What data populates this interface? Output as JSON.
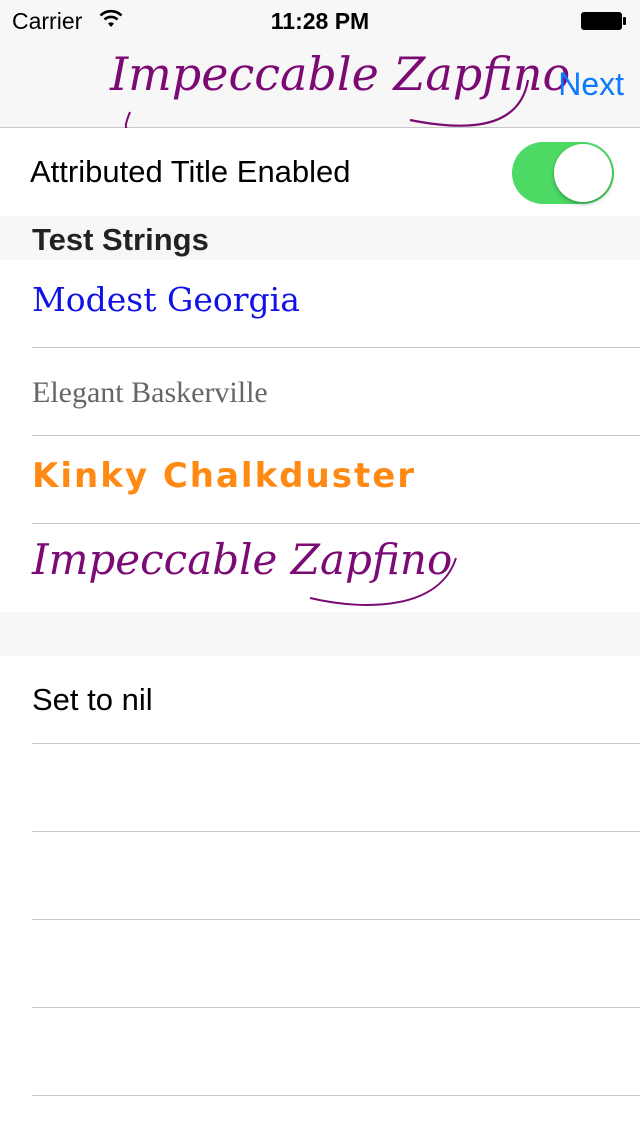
{
  "status_bar": {
    "carrier": "Carrier",
    "time": "11:28 PM"
  },
  "nav": {
    "title": "Impeccable Zapfino",
    "next_label": "Next",
    "title_color": "#7b0a74",
    "accent": "#0a7aff"
  },
  "toggle": {
    "label": "Attributed Title Enabled",
    "on": true,
    "color": "#4cd964"
  },
  "section": {
    "header": "Test Strings"
  },
  "test_strings": [
    {
      "label": "Modest Georgia",
      "color": "#1212e6"
    },
    {
      "label": "Elegant Baskerville",
      "color": "#666666"
    },
    {
      "label": "Kinky Chalkduster",
      "color": "#ff8a13"
    },
    {
      "label": "Impeccable Zapfino",
      "color": "#7b0a74"
    }
  ],
  "actions": {
    "set_nil": "Set to nil"
  }
}
